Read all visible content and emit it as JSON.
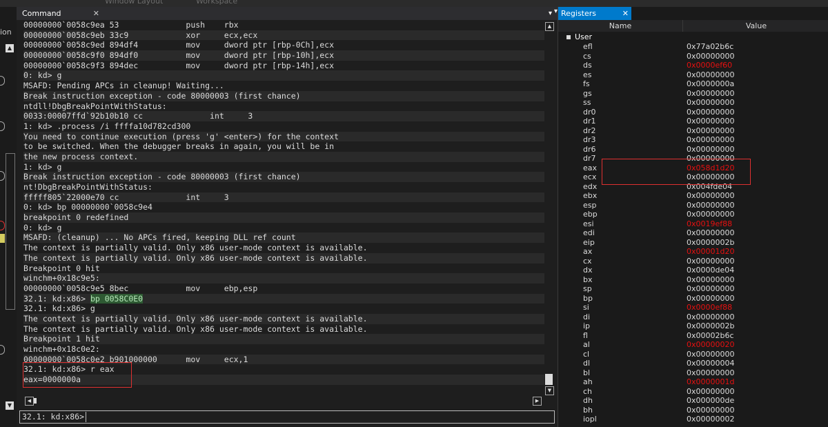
{
  "topbar": {
    "items": [
      "Window Layout",
      "Workspace"
    ]
  },
  "left_strip": {
    "fragment": "ion"
  },
  "command": {
    "tab_label": "Command",
    "lines": [
      {
        "pre": "00000000`0058c9ea 53              push    rbx",
        "hl": "",
        "post": ""
      },
      {
        "pre": "00000000`0058c9eb 33c9            xor     ecx,ecx",
        "hl": "",
        "post": ""
      },
      {
        "pre": "00000000`0058c9ed 894df4          mov     dword ptr [rbp-0Ch],ecx",
        "hl": "",
        "post": ""
      },
      {
        "pre": "00000000`0058c9f0 894df0          mov     dword ptr [rbp-10h],ecx",
        "hl": "",
        "post": ""
      },
      {
        "pre": "00000000`0058c9f3 894dec          mov     dword ptr [rbp-14h],ecx",
        "hl": "",
        "post": ""
      },
      {
        "pre": "0: kd> g",
        "hl": "",
        "post": ""
      },
      {
        "pre": "MSAFD: Pending APCs in cleanup! Waiting...",
        "hl": "",
        "post": ""
      },
      {
        "pre": "Break instruction exception - code 80000003 (first chance)",
        "hl": "",
        "post": ""
      },
      {
        "pre": "ntdll!DbgBreakPointWithStatus:",
        "hl": "",
        "post": ""
      },
      {
        "pre": "0033:00007ffd`92b10b10 cc              int     3",
        "hl": "",
        "post": ""
      },
      {
        "pre": "1: kd> .process /i ffffa10d782cd300",
        "hl": "",
        "post": ""
      },
      {
        "pre": "You need to continue execution (press 'g' <enter>) for the context",
        "hl": "",
        "post": ""
      },
      {
        "pre": "to be switched. When the debugger breaks in again, you will be in",
        "hl": "",
        "post": ""
      },
      {
        "pre": "the new process context.",
        "hl": "",
        "post": ""
      },
      {
        "pre": "1: kd> g",
        "hl": "",
        "post": ""
      },
      {
        "pre": "Break instruction exception - code 80000003 (first chance)",
        "hl": "",
        "post": ""
      },
      {
        "pre": "nt!DbgBreakPointWithStatus:",
        "hl": "",
        "post": ""
      },
      {
        "pre": "fffff805`22000e70 cc              int     3",
        "hl": "",
        "post": ""
      },
      {
        "pre": "0: kd> bp 00000000`0058c9e4",
        "hl": "",
        "post": ""
      },
      {
        "pre": "breakpoint 0 redefined",
        "hl": "",
        "post": ""
      },
      {
        "pre": "0: kd> g",
        "hl": "",
        "post": ""
      },
      {
        "pre": "MSAFD: (cleanup) ... No APCs fired, keeping DLL ref count",
        "hl": "",
        "post": ""
      },
      {
        "pre": "The context is partially valid. Only x86 user-mode context is available.",
        "hl": "",
        "post": ""
      },
      {
        "pre": "The context is partially valid. Only x86 user-mode context is available.",
        "hl": "",
        "post": ""
      },
      {
        "pre": "Breakpoint 0 hit",
        "hl": "",
        "post": ""
      },
      {
        "pre": "winchm+0x18c9e5:",
        "hl": "",
        "post": ""
      },
      {
        "pre": "00000000`0058c9e5 8bec            mov     ebp,esp",
        "hl": "",
        "post": ""
      },
      {
        "pre": "32.1: kd:x86> ",
        "hl": "bp 0058C0E0",
        "post": ""
      },
      {
        "pre": "32.1: kd:x86> g",
        "hl": "",
        "post": ""
      },
      {
        "pre": "The context is partially valid. Only x86 user-mode context is available.",
        "hl": "",
        "post": ""
      },
      {
        "pre": "The context is partially valid. Only x86 user-mode context is available.",
        "hl": "",
        "post": ""
      },
      {
        "pre": "Breakpoint 1 hit",
        "hl": "",
        "post": ""
      },
      {
        "pre": "winchm+0x18c0e2:",
        "hl": "",
        "post": ""
      },
      {
        "pre": "00000000`0058c0e2 b901000000      mov     ecx,1",
        "hl": "",
        "post": ""
      },
      {
        "pre": "32.1: kd:x86> r eax",
        "hl": "",
        "post": ""
      },
      {
        "pre": "eax=0000000a",
        "hl": "",
        "post": ""
      }
    ],
    "prompt": "32.1: kd:x86>",
    "input_value": ""
  },
  "registers": {
    "tab_label": "Registers",
    "col_name": "Name",
    "col_value": "Value",
    "group": "User",
    "items": [
      {
        "name": "efl",
        "value": "0x77a02b6c",
        "changed": false
      },
      {
        "name": "cs",
        "value": "0x00000000",
        "changed": false
      },
      {
        "name": "ds",
        "value": "0x0000ef60",
        "changed": true
      },
      {
        "name": "es",
        "value": "0x00000000",
        "changed": false
      },
      {
        "name": "fs",
        "value": "0x0000000a",
        "changed": false
      },
      {
        "name": "gs",
        "value": "0x00000000",
        "changed": false
      },
      {
        "name": "ss",
        "value": "0x00000000",
        "changed": false
      },
      {
        "name": "dr0",
        "value": "0x00000000",
        "changed": false
      },
      {
        "name": "dr1",
        "value": "0x00000000",
        "changed": false
      },
      {
        "name": "dr2",
        "value": "0x00000000",
        "changed": false
      },
      {
        "name": "dr3",
        "value": "0x00000000",
        "changed": false
      },
      {
        "name": "dr6",
        "value": "0x00000000",
        "changed": false
      },
      {
        "name": "dr7",
        "value": "0x00000000",
        "changed": false
      },
      {
        "name": "eax",
        "value": "0x058d1d20",
        "changed": true
      },
      {
        "name": "ecx",
        "value": "0x00000000",
        "changed": false
      },
      {
        "name": "edx",
        "value": "0x004fde04",
        "changed": false
      },
      {
        "name": "ebx",
        "value": "0x00000000",
        "changed": false
      },
      {
        "name": "esp",
        "value": "0x00000000",
        "changed": false
      },
      {
        "name": "ebp",
        "value": "0x00000000",
        "changed": false
      },
      {
        "name": "esi",
        "value": "0x0019ef88",
        "changed": true
      },
      {
        "name": "edi",
        "value": "0x00000000",
        "changed": false
      },
      {
        "name": "eip",
        "value": "0x0000002b",
        "changed": false
      },
      {
        "name": "ax",
        "value": "0x00001d20",
        "changed": true
      },
      {
        "name": "cx",
        "value": "0x00000000",
        "changed": false
      },
      {
        "name": "dx",
        "value": "0x0000de04",
        "changed": false
      },
      {
        "name": "bx",
        "value": "0x00000000",
        "changed": false
      },
      {
        "name": "sp",
        "value": "0x00000000",
        "changed": false
      },
      {
        "name": "bp",
        "value": "0x00000000",
        "changed": false
      },
      {
        "name": "si",
        "value": "0x0000ef88",
        "changed": true
      },
      {
        "name": "di",
        "value": "0x00000000",
        "changed": false
      },
      {
        "name": "ip",
        "value": "0x0000002b",
        "changed": false
      },
      {
        "name": "fl",
        "value": "0x00002b6c",
        "changed": false
      },
      {
        "name": "al",
        "value": "0x00000020",
        "changed": true
      },
      {
        "name": "cl",
        "value": "0x00000000",
        "changed": false
      },
      {
        "name": "dl",
        "value": "0x00000004",
        "changed": false
      },
      {
        "name": "bl",
        "value": "0x00000000",
        "changed": false
      },
      {
        "name": "ah",
        "value": "0x0000001d",
        "changed": true
      },
      {
        "name": "ch",
        "value": "0x00000000",
        "changed": false
      },
      {
        "name": "dh",
        "value": "0x000000de",
        "changed": false
      },
      {
        "name": "bh",
        "value": "0x00000000",
        "changed": false
      },
      {
        "name": "iopl",
        "value": "0x00000002",
        "changed": false
      }
    ]
  },
  "colors": {
    "changed_value": "#e81010",
    "highlight_bg": "#2e5a33",
    "annotation_box": "#e03030",
    "active_tab": "#007acc"
  }
}
